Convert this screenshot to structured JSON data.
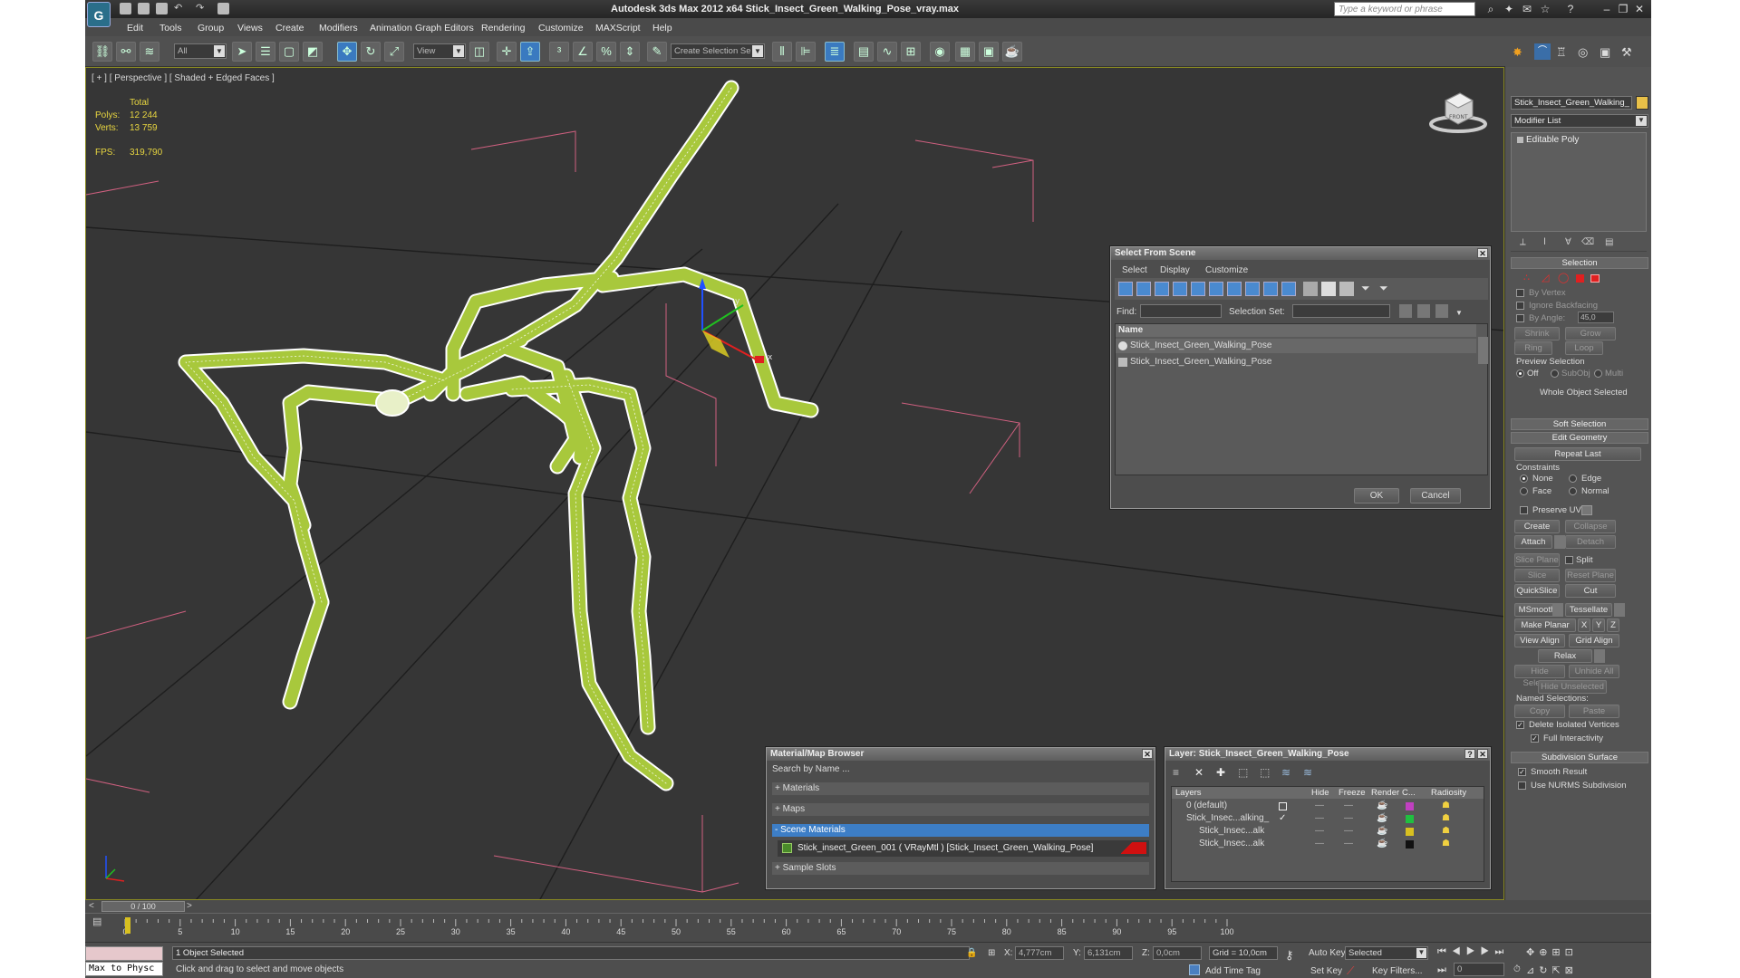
{
  "window": {
    "title": "Autodesk 3ds Max  2012 x64     Stick_Insect_Green_Walking_Pose_vray.max",
    "search_placeholder": "Type a keyword or phrase"
  },
  "menu": [
    "Edit",
    "Tools",
    "Group",
    "Views",
    "Create",
    "Modifiers",
    "Animation",
    "Graph Editors",
    "Rendering",
    "Customize",
    "MAXScript",
    "Help"
  ],
  "toolbar": {
    "filter_value": "All",
    "refcoord_value": "View",
    "named_sel_placeholder": "Create Selection Se"
  },
  "viewport": {
    "label": "[ + ] [ Perspective ] [ Shaded + Edged Faces ]",
    "stats_header": "Total",
    "polys_label": "Polys:",
    "polys_value": "12 244",
    "verts_label": "Verts:",
    "verts_value": "13 759",
    "fps_label": "FPS:",
    "fps_value": "319,790",
    "mesh_color": "#a8c83c",
    "wire_color": "#ffffff",
    "viewcube_label": "FRONT"
  },
  "select_from_scene": {
    "title": "Select From Scene",
    "menu": [
      "Select",
      "Display",
      "Customize"
    ],
    "find_label": "Find:",
    "selection_set_label": "Selection Set:",
    "column_name": "Name",
    "items": [
      "Stick_Insect_Green_Walking_Pose",
      "Stick_Insect_Green_Walking_Pose"
    ],
    "ok": "OK",
    "cancel": "Cancel"
  },
  "material_browser": {
    "title": "Material/Map Browser",
    "search_placeholder": "Search by Name ...",
    "groups": [
      "+ Materials",
      "+ Maps",
      "- Scene Materials",
      "+ Sample Slots"
    ],
    "scene_material": "Stick_insect_Green_001  ( VRayMtl )  [Stick_Insect_Green_Walking_Pose]"
  },
  "layer_dialog": {
    "title": "Layer: Stick_Insect_Green_Walking_Pose",
    "columns": [
      "Layers",
      "Hide",
      "Freeze",
      "Render",
      "C...",
      "Radiosity"
    ],
    "rows": [
      {
        "name": "0 (default)",
        "color": "#c040c0"
      },
      {
        "name": "Stick_Insec...alking_",
        "color": "#20c040"
      },
      {
        "name": "Stick_Insec...alk",
        "color": "#d8c020"
      },
      {
        "name": "Stick_Insec...alk",
        "color": "#111111"
      }
    ]
  },
  "command_panel": {
    "object_name": "Stick_Insect_Green_Walking_",
    "object_color": "#e8c048",
    "modifier_list": "Modifier List",
    "stack_item": "Editable Poly",
    "selection_title": "Selection",
    "by_vertex": "By Vertex",
    "ignore_backfacing": "Ignore Backfacing",
    "by_angle": "By Angle:",
    "angle_value": "45,0",
    "shrink": "Shrink",
    "grow": "Grow",
    "ring": "Ring",
    "loop": "Loop",
    "preview_selection": "Preview Selection",
    "preview_off": "Off",
    "preview_subobj": "SubObj",
    "preview_multi": "Multi",
    "whole_object": "Whole Object Selected",
    "soft_selection": "Soft Selection",
    "edit_geometry": "Edit Geometry",
    "repeat_last": "Repeat Last",
    "constraints": "Constraints",
    "c_none": "None",
    "c_edge": "Edge",
    "c_face": "Face",
    "c_normal": "Normal",
    "preserve_uvs": "Preserve UVs",
    "create": "Create",
    "collapse": "Collapse",
    "attach": "Attach",
    "detach": "Detach",
    "slice_plane": "Slice Plane",
    "split": "Split",
    "slice": "Slice",
    "reset_plane": "Reset Plane",
    "quickslice": "QuickSlice",
    "cut": "Cut",
    "msmooth": "MSmooth",
    "tessellate": "Tessellate",
    "make_planar": "Make Planar",
    "x": "X",
    "y": "Y",
    "z": "Z",
    "view_align": "View Align",
    "grid_align": "Grid Align",
    "relax": "Relax",
    "hide_selected": "Hide Selected",
    "unhide_all": "Unhide All",
    "hide_unselected": "Hide Unselected",
    "named_selections": "Named Selections:",
    "copy": "Copy",
    "paste": "Paste",
    "delete_isolated": "Delete Isolated Vertices",
    "full_interactivity": "Full Interactivity",
    "subdivision_surface": "Subdivision Surface",
    "smooth_result": "Smooth Result",
    "use_nurms": "Use NURMS Subdivision"
  },
  "timeline": {
    "frame_label": "0 / 100",
    "ticks": [
      "0",
      "5",
      "10",
      "15",
      "20",
      "25",
      "30",
      "35",
      "40",
      "45",
      "50",
      "55",
      "60",
      "65",
      "70",
      "75",
      "80",
      "85",
      "90",
      "95",
      "100"
    ]
  },
  "status": {
    "maxscript": "Max to Physc",
    "selected": "1 Object Selected",
    "prompt": "Click and drag to select and move objects",
    "x_label": "X:",
    "x_value": "4,777cm",
    "y_label": "Y:",
    "y_value": "6,131cm",
    "z_label": "Z:",
    "z_value": "0,0cm",
    "grid": "Grid = 10,0cm",
    "auto_key": "Auto Key",
    "set_key": "Set Key",
    "key_mode": "Selected",
    "key_filters": "Key Filters...",
    "add_time_tag": "Add Time Tag",
    "frame_value": "0"
  }
}
